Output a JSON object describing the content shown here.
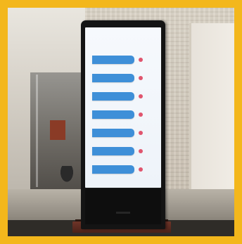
{
  "photo": {
    "subject": "digital-directory-kiosk",
    "border_color": "#f3b71c"
  },
  "screen": {
    "title_lines": [
      "",
      "",
      ""
    ],
    "accent_color": "#3e8fd8",
    "badge_color": "#e0556e",
    "entries": [
      {
        "name": "",
        "sub": "",
        "badge": ""
      },
      {
        "name": "",
        "sub": "",
        "badge": ""
      },
      {
        "name": "",
        "sub": "",
        "badge": ""
      },
      {
        "name": "",
        "sub": "",
        "badge": ""
      },
      {
        "name": "",
        "sub": "",
        "badge": ""
      },
      {
        "name": "",
        "sub": "",
        "badge": ""
      },
      {
        "name": "",
        "sub": "",
        "badge": ""
      }
    ]
  }
}
